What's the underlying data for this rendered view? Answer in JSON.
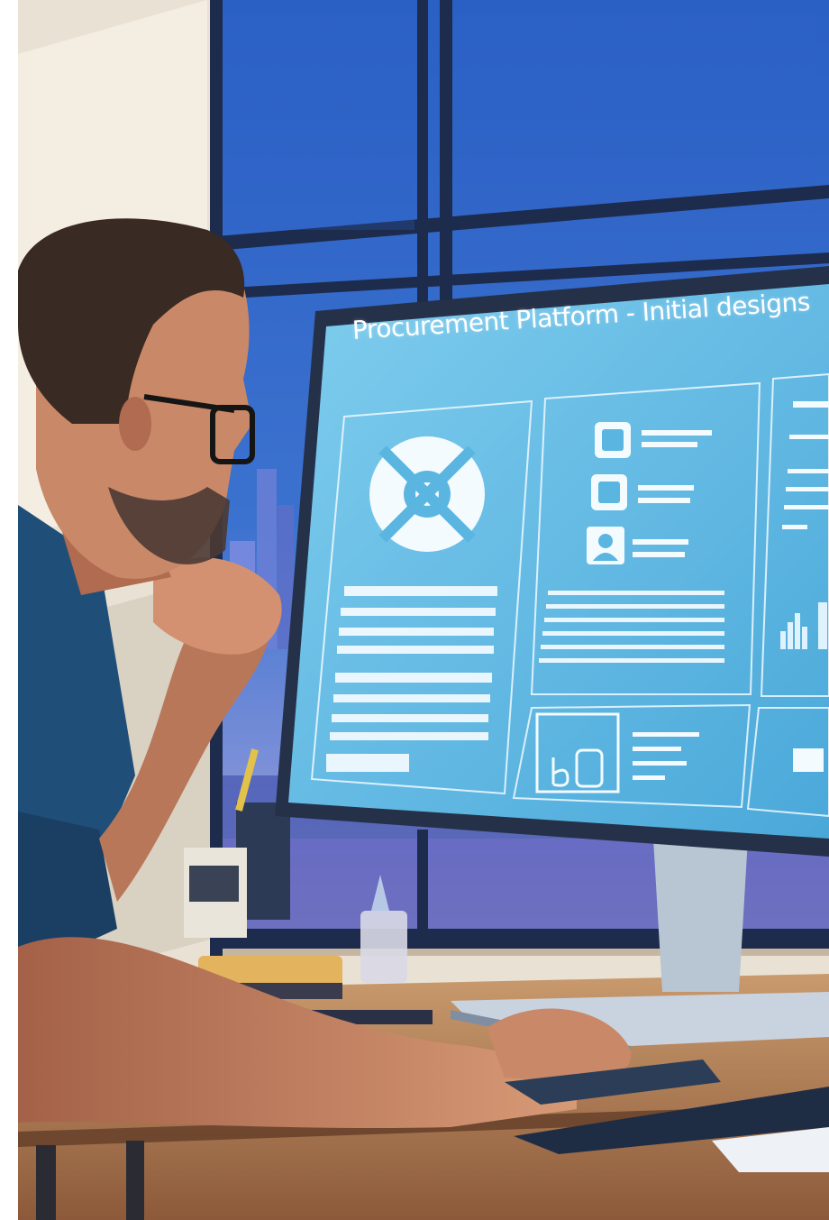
{
  "image": {
    "description_free": true
  },
  "monitor": {
    "title": "Procurement Platform - Initial designs"
  },
  "colors": {
    "screen": "#5db8e3",
    "screen_light": "#8fd1ee",
    "sky": "#2f5fbf",
    "wall": "#f1eadc",
    "desk": "#b07a4f",
    "shirt": "#1f4f78",
    "skin": "#c98867",
    "hair": "#3a2a24"
  },
  "icons": [
    "logo-icon",
    "checkbox-icon",
    "user-icon",
    "bar-chart-icon",
    "camera-icon"
  ]
}
